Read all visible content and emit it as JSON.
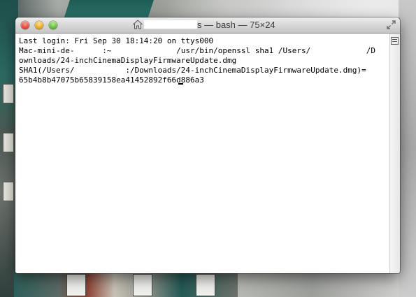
{
  "window": {
    "title_suffix": "s — bash — 75×24"
  },
  "terminal": {
    "lines": [
      "Last login: Fri Sep 30 18:14:20 on ttys000",
      "Mac-mini-de-      :~              /usr/bin/openssl sha1 /Users/            /D",
      "ownloads/24-inchCinemaDisplayFirmwareUpdate.dmg",
      "SHA1(/Users/           :/Downloads/24-inchCinemaDisplayFirmwareUpdate.dmg)=",
      "65b4b8b47075b65839158ea41452892f66d886a3"
    ]
  },
  "icons": {
    "close": "close-icon",
    "minimize": "minimize-icon",
    "zoom": "zoom-icon",
    "home": "home-folder-icon",
    "fullscreen": "fullscreen-icon",
    "split": "split-pane-icon"
  },
  "colors": {
    "close": "#e0443a",
    "minimize": "#e3a51f",
    "zoom": "#5fb93a",
    "terminal_bg": "#ffffff",
    "terminal_text": "#000000"
  }
}
